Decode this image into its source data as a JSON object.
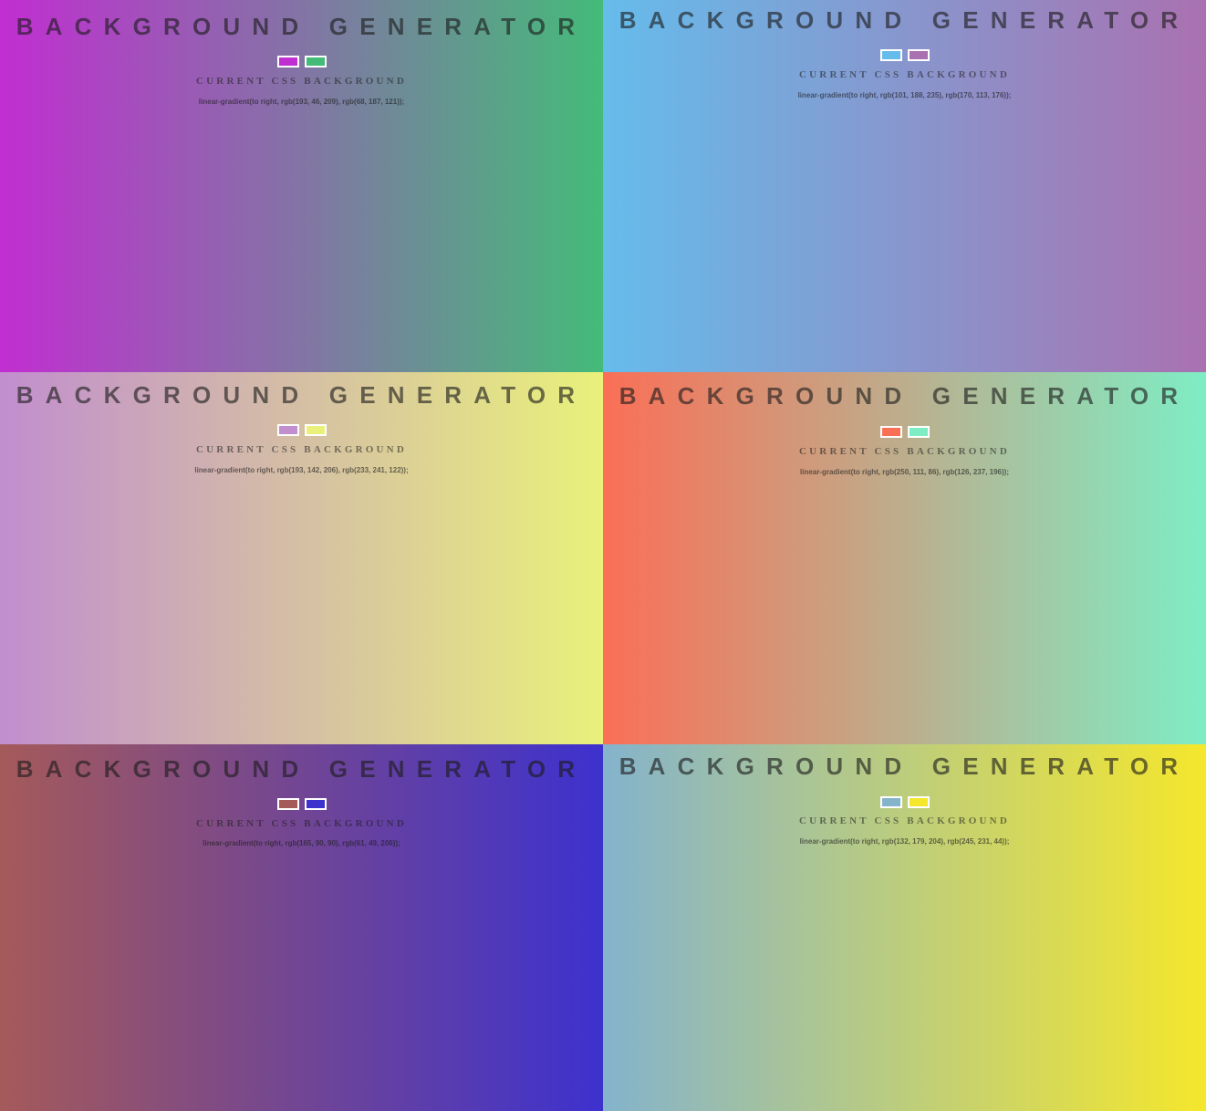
{
  "panels": [
    {
      "title": "BACKGROUND GENERATOR",
      "subtitle": "CURRENT CSS BACKGROUND",
      "css": "linear-gradient(to right, rgb(193, 46, 209), rgb(68, 187, 121));",
      "color1": "#c12ed1",
      "color2": "#44bb79"
    },
    {
      "title": "BACKGROUND GENERATOR",
      "subtitle": "CURRENT CSS BACKGROUND",
      "css": "linear-gradient(to right, rgb(101, 188, 235), rgb(170, 113, 176));",
      "color1": "#65bceb",
      "color2": "#aa71b0"
    },
    {
      "title": "BACKGROUND GENERATOR",
      "subtitle": "CURRENT CSS BACKGROUND",
      "css": "linear-gradient(to right, rgb(193, 142, 206), rgb(233, 241, 122));",
      "color1": "#c18ece",
      "color2": "#e9f17a"
    },
    {
      "title": "BACKGROUND GENERATOR",
      "subtitle": "CURRENT CSS BACKGROUND",
      "css": "linear-gradient(to right, rgb(250, 111, 86), rgb(126, 237, 196));",
      "color1": "#fa6f56",
      "color2": "#7eedc4"
    },
    {
      "title": "BACKGROUND GENERATOR",
      "subtitle": "CURRENT CSS BACKGROUND",
      "css": "linear-gradient(to right, rgb(165, 90, 90), rgb(61, 49, 206));",
      "color1": "#a55a5a",
      "color2": "#3d31ce"
    },
    {
      "title": "BACKGROUND GENERATOR",
      "subtitle": "CURRENT CSS BACKGROUND",
      "css": "linear-gradient(to right, rgb(132, 179, 204), rgb(245, 231, 44));",
      "color1": "#84b3cc",
      "color2": "#f5e72c"
    }
  ]
}
